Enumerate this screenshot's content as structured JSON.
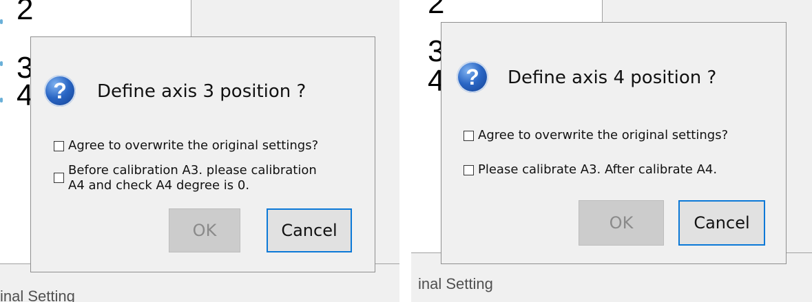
{
  "left": {
    "numbers": [
      "2",
      "3",
      "4"
    ],
    "footer": "inal Setting",
    "dialog": {
      "title": "Define axis 3 position ?",
      "options": [
        "Agree to overwrite the original settings?",
        "Before calibration A3. please calibration\nA4 and check A4 degree is 0."
      ],
      "ok_label": "OK",
      "cancel_label": "Cancel"
    }
  },
  "right": {
    "numbers": [
      "2",
      "3",
      "4"
    ],
    "footer": "inal Setting",
    "dialog": {
      "title": "Define axis 4 position ?",
      "options": [
        "Agree to overwrite the original settings?",
        "Please calibrate A3. After calibrate A4."
      ],
      "ok_label": "OK",
      "cancel_label": "Cancel"
    }
  },
  "icons": {
    "dialog_icon": "question-help-icon"
  },
  "colors": {
    "dialog_bg": "#f0f0f0",
    "cancel_border": "#0a78d7",
    "ok_disabled": "#cccccc"
  }
}
